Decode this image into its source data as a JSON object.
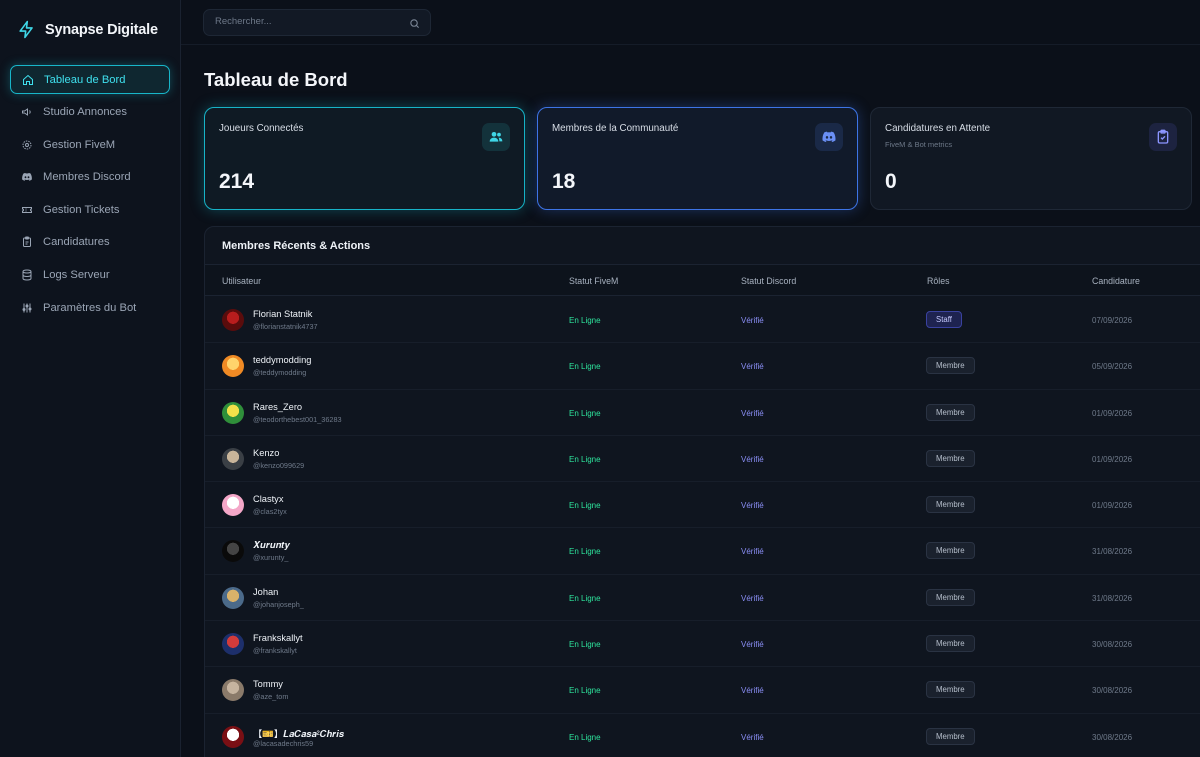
{
  "brand": {
    "name": "Synapse Digitale"
  },
  "search": {
    "placeholder": "Rechercher..."
  },
  "sidebar": {
    "items": [
      {
        "label": "Tableau de Bord",
        "icon": "home-icon",
        "active": true
      },
      {
        "label": "Studio Annonces",
        "icon": "megaphone-icon"
      },
      {
        "label": "Gestion FiveM",
        "icon": "gear-icon"
      },
      {
        "label": "Membres Discord",
        "icon": "discord-icon"
      },
      {
        "label": "Gestion Tickets",
        "icon": "ticket-icon"
      },
      {
        "label": "Candidatures",
        "icon": "clipboard-icon"
      },
      {
        "label": "Logs Serveur",
        "icon": "database-icon"
      },
      {
        "label": "Paramètres du Bot",
        "icon": "sliders-icon"
      }
    ]
  },
  "page": {
    "title": "Tableau de Bord"
  },
  "stats": [
    {
      "title": "Joueurs Connectés",
      "subtitle": "",
      "value": "214",
      "icon": "users-icon",
      "color": "#17b3c7"
    },
    {
      "title": "Membres de la Communauté",
      "subtitle": "",
      "value": "18",
      "icon": "discord-icon",
      "color": "#3d74e6"
    },
    {
      "title": "Candidatures en Attente",
      "subtitle": "FiveM & Bot metrics",
      "value": "0",
      "icon": "clipboard-check-icon",
      "color": "#6f79f0"
    }
  ],
  "members": {
    "title": "Membres Récents & Actions",
    "columns": [
      "Utilisateur",
      "Statut FiveM",
      "Statut Discord",
      "Rôles",
      "Candidature"
    ],
    "rows": [
      {
        "name": "Florian Statnik",
        "handle": "@florianstatnik4737",
        "fivem": "En Ligne",
        "discord": "Vérifié",
        "role": "Staff",
        "date": "07/09/2026",
        "avatar": [
          "#5a0c0c",
          "#b81d1d"
        ]
      },
      {
        "name": "teddymodding",
        "handle": "@teddymodding",
        "fivem": "En Ligne",
        "discord": "Vérifié",
        "role": "Membre",
        "date": "05/09/2026",
        "avatar": [
          "#f08a24",
          "#ffd36b"
        ]
      },
      {
        "name": "Rares_Zero",
        "handle": "@teodorthebest001_36283",
        "fivem": "En Ligne",
        "discord": "Vérifié",
        "role": "Membre",
        "date": "01/09/2026",
        "avatar": [
          "#2f8f3a",
          "#f2e14a"
        ]
      },
      {
        "name": "Kenzo",
        "handle": "@kenzo099629",
        "fivem": "En Ligne",
        "discord": "Vérifié",
        "role": "Membre",
        "date": "01/09/2026",
        "avatar": [
          "#3a3f45",
          "#c9b59a"
        ]
      },
      {
        "name": "Clastyx",
        "handle": "@clas2tyx",
        "fivem": "En Ligne",
        "discord": "Vérifié",
        "role": "Membre",
        "date": "01/09/2026",
        "avatar": [
          "#f4a7c8",
          "#ffffff"
        ]
      },
      {
        "name": "𝑿𝒖𝒓𝒖𝒏𝒕𝒚",
        "handle": "@xurunty_",
        "fivem": "En Ligne",
        "discord": "Vérifié",
        "role": "Membre",
        "date": "31/08/2026",
        "avatar": [
          "#0a0a0a",
          "#444444"
        ]
      },
      {
        "name": "Johan",
        "handle": "@johanjoseph_",
        "fivem": "En Ligne",
        "discord": "Vérifié",
        "role": "Membre",
        "date": "31/08/2026",
        "avatar": [
          "#4b6a8a",
          "#d9b26a"
        ]
      },
      {
        "name": "Frankskallyt",
        "handle": "@frankskallyt",
        "fivem": "En Ligne",
        "discord": "Vérifié",
        "role": "Membre",
        "date": "30/08/2026",
        "avatar": [
          "#1d2f6b",
          "#d23b3b"
        ]
      },
      {
        "name": "Tommy",
        "handle": "@aze_tom",
        "fivem": "En Ligne",
        "discord": "Vérifié",
        "role": "Membre",
        "date": "30/08/2026",
        "avatar": [
          "#8a7a6a",
          "#c6b4a0"
        ]
      },
      {
        "name": "【🎫】𝑳𝒂𝑪𝒂𝒔𝒂²𝑪𝒉𝒓𝒊𝒔",
        "handle": "@lacasadechris59",
        "fivem": "En Ligne",
        "discord": "Vérifié",
        "role": "Membre",
        "date": "30/08/2026",
        "avatar": [
          "#7a0f14",
          "#ffffff"
        ]
      }
    ]
  }
}
